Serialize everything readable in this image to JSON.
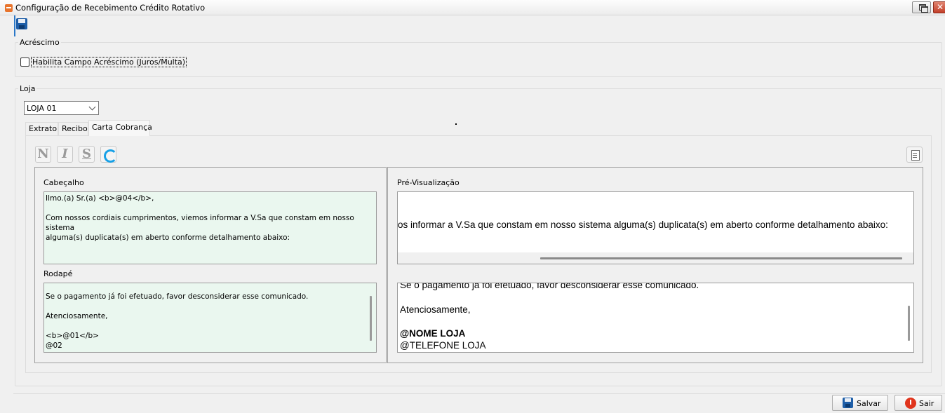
{
  "window": {
    "title": "Configuração de Recebimento Crédito Rotativo"
  },
  "acrescimo": {
    "legend": "Acréscimo",
    "checkbox_label": "Habilita Campo Acréscimo (Juros/Multa)",
    "checked": false
  },
  "loja": {
    "legend": "Loja",
    "selected": "LOJA 01"
  },
  "tabs": [
    {
      "label": "Extrato",
      "active": false
    },
    {
      "label": "Recibo",
      "active": false
    },
    {
      "label": "Carta Cobrança",
      "active": true
    }
  ],
  "format_toolbar": {
    "bold": "N",
    "italic": "I",
    "strike": "S"
  },
  "editor": {
    "header_label": "Cabeçalho",
    "header_lines": [
      "Ilmo.(a) Sr.(a) <b>@04</b>,",
      "",
      "Com nossos cordiais cumprimentos, viemos informar a V.Sa que constam em nosso sistema",
      "alguma(s) duplicata(s) em aberto conforme detalhamento abaixo:"
    ],
    "footer_label": "Rodapé",
    "footer_lines": [
      "",
      "Se o pagamento já foi efetuado, favor desconsiderar esse comunicado.",
      "",
      "Atenciosamente,",
      "",
      "<b>@01</b>",
      "@02"
    ]
  },
  "preview": {
    "label": "Pré-Visualização",
    "header_text": "os informar a V.Sa que constam em nosso sistema alguma(s) duplicata(s) em aberto conforme detalhamento abaixo:",
    "footer_cut_line": "Se o pagamento já foi efetuado, favor desconsiderar esse comunicado.",
    "footer_regards": "Atenciosamente,",
    "footer_store_name": "@NOME LOJA",
    "footer_store_phone": "@TELEFONE LOJA"
  },
  "buttons": {
    "save": "Salvar",
    "exit": "Sair"
  }
}
